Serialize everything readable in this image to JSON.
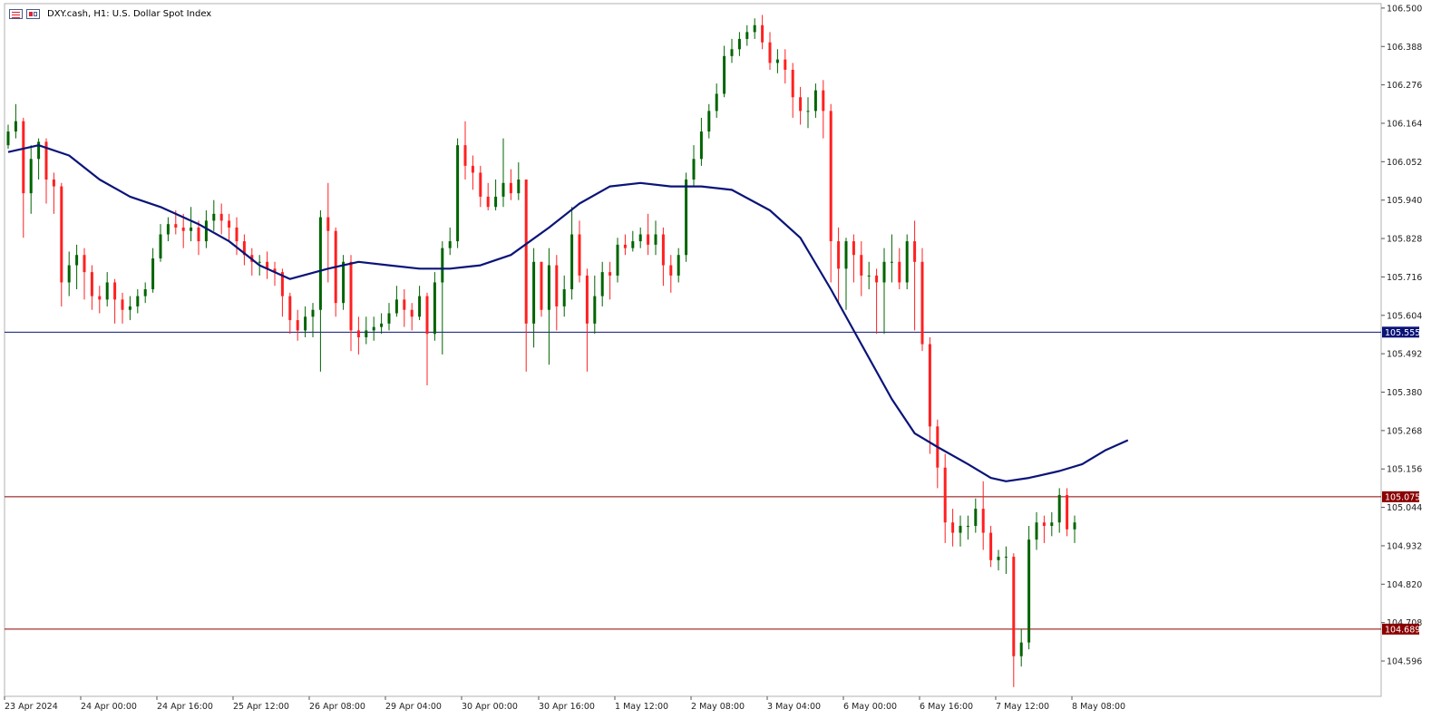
{
  "header": {
    "title": "DXY.cash, H1:  U.S. Dollar Spot Index"
  },
  "colors": {
    "up": "#006400",
    "down": "#ff2020",
    "ma": "#0a1478",
    "hline_current": "#0a1478",
    "hline_support": "#8b0000",
    "grid_frame": "#b0b0b0"
  },
  "chart_data": {
    "type": "candlestick",
    "title": "DXY.cash, H1:  U.S. Dollar Spot Index",
    "ylim": [
      104.53,
      106.505
    ],
    "y_ticks": [
      "106.500",
      "106.388",
      "106.276",
      "106.164",
      "106.052",
      "105.940",
      "105.828",
      "105.716",
      "105.604",
      "105.492",
      "105.380",
      "105.268",
      "105.156",
      "105.044",
      "104.932",
      "104.820",
      "104.708",
      "104.596"
    ],
    "x_ticks": [
      "23 Apr 2024",
      "24 Apr 00:00",
      "24 Apr 16:00",
      "25 Apr 12:00",
      "26 Apr 08:00",
      "29 Apr 04:00",
      "30 Apr 00:00",
      "30 Apr 16:00",
      "1 May 12:00",
      "2 May 08:00",
      "3 May 04:00",
      "6 May 00:00",
      "6 May 16:00",
      "7 May 12:00",
      "8 May 08:00"
    ],
    "hlines": [
      {
        "value": 105.555,
        "label": "105.555",
        "role": "current"
      },
      {
        "value": 105.075,
        "label": "105.075",
        "role": "support"
      },
      {
        "value": 104.689,
        "label": "104.689",
        "role": "support"
      }
    ],
    "ma_path": [
      [
        0,
        106.08
      ],
      [
        4,
        106.1
      ],
      [
        8,
        106.07
      ],
      [
        12,
        106.0
      ],
      [
        16,
        105.95
      ],
      [
        20,
        105.92
      ],
      [
        25,
        105.87
      ],
      [
        29,
        105.82
      ],
      [
        33,
        105.75
      ],
      [
        37,
        105.71
      ],
      [
        42,
        105.74
      ],
      [
        46,
        105.76
      ],
      [
        50,
        105.75
      ],
      [
        54,
        105.74
      ],
      [
        58,
        105.74
      ],
      [
        62,
        105.75
      ],
      [
        66,
        105.78
      ],
      [
        71,
        105.86
      ],
      [
        75,
        105.93
      ],
      [
        79,
        105.98
      ],
      [
        83,
        105.99
      ],
      [
        87,
        105.98
      ],
      [
        91,
        105.98
      ],
      [
        95,
        105.97
      ],
      [
        100,
        105.91
      ],
      [
        104,
        105.83
      ],
      [
        108,
        105.68
      ],
      [
        112,
        105.52
      ],
      [
        116,
        105.36
      ],
      [
        119,
        105.26
      ],
      [
        122,
        105.22
      ],
      [
        126,
        105.17
      ],
      [
        129,
        105.13
      ],
      [
        131,
        105.12
      ],
      [
        134,
        105.13
      ],
      [
        138,
        105.15
      ],
      [
        141,
        105.17
      ],
      [
        144,
        105.21
      ],
      [
        147,
        105.24
      ]
    ],
    "candles": [
      [
        106.1,
        106.14,
        106.16,
        106.09
      ],
      [
        106.14,
        106.17,
        106.22,
        106.12
      ],
      [
        106.17,
        105.96,
        106.18,
        105.83
      ],
      [
        105.96,
        106.06,
        106.1,
        105.9
      ],
      [
        106.06,
        106.11,
        106.12,
        106.0
      ],
      [
        106.11,
        106.0,
        106.12,
        105.93
      ],
      [
        106.0,
        105.98,
        106.02,
        105.9
      ],
      [
        105.98,
        105.7,
        105.99,
        105.63
      ],
      [
        105.7,
        105.75,
        105.79,
        105.66
      ],
      [
        105.75,
        105.78,
        105.81,
        105.68
      ],
      [
        105.78,
        105.73,
        105.8,
        105.65
      ],
      [
        105.73,
        105.66,
        105.75,
        105.62
      ],
      [
        105.66,
        105.65,
        105.69,
        105.61
      ],
      [
        105.65,
        105.7,
        105.73,
        105.63
      ],
      [
        105.7,
        105.65,
        105.71,
        105.58
      ],
      [
        105.65,
        105.62,
        105.67,
        105.58
      ],
      [
        105.62,
        105.63,
        105.66,
        105.59
      ],
      [
        105.63,
        105.66,
        105.68,
        105.61
      ],
      [
        105.66,
        105.68,
        105.7,
        105.64
      ],
      [
        105.68,
        105.77,
        105.8,
        105.67
      ],
      [
        105.77,
        105.84,
        105.87,
        105.76
      ],
      [
        105.84,
        105.87,
        105.89,
        105.82
      ],
      [
        105.87,
        105.86,
        105.91,
        105.84
      ],
      [
        105.86,
        105.85,
        105.9,
        105.8
      ],
      [
        105.85,
        105.86,
        105.92,
        105.82
      ],
      [
        105.86,
        105.82,
        105.88,
        105.78
      ],
      [
        105.82,
        105.88,
        105.91,
        105.8
      ],
      [
        105.88,
        105.9,
        105.94,
        105.85
      ],
      [
        105.9,
        105.88,
        105.93,
        105.84
      ],
      [
        105.88,
        105.86,
        105.9,
        105.82
      ],
      [
        105.86,
        105.82,
        105.89,
        105.78
      ],
      [
        105.82,
        105.78,
        105.84,
        105.75
      ],
      [
        105.78,
        105.76,
        105.8,
        105.72
      ],
      [
        105.76,
        105.76,
        105.78,
        105.72
      ],
      [
        105.76,
        105.74,
        105.79,
        105.71
      ],
      [
        105.74,
        105.73,
        105.76,
        105.69
      ],
      [
        105.73,
        105.66,
        105.74,
        105.6
      ],
      [
        105.66,
        105.59,
        105.67,
        105.55
      ],
      [
        105.59,
        105.56,
        105.62,
        105.53
      ],
      [
        105.56,
        105.6,
        105.63,
        105.54
      ],
      [
        105.6,
        105.62,
        105.64,
        105.54
      ],
      [
        105.62,
        105.89,
        105.91,
        105.44
      ],
      [
        105.89,
        105.85,
        105.99,
        105.7
      ],
      [
        105.85,
        105.64,
        105.86,
        105.6
      ],
      [
        105.64,
        105.76,
        105.78,
        105.62
      ],
      [
        105.76,
        105.56,
        105.78,
        105.5
      ],
      [
        105.56,
        105.54,
        105.6,
        105.49
      ],
      [
        105.54,
        105.56,
        105.6,
        105.52
      ],
      [
        105.56,
        105.57,
        105.6,
        105.53
      ],
      [
        105.57,
        105.58,
        105.61,
        105.55
      ],
      [
        105.58,
        105.61,
        105.64,
        105.56
      ],
      [
        105.61,
        105.65,
        105.69,
        105.6
      ],
      [
        105.65,
        105.62,
        105.68,
        105.57
      ],
      [
        105.62,
        105.6,
        105.64,
        105.56
      ],
      [
        105.6,
        105.66,
        105.69,
        105.59
      ],
      [
        105.66,
        105.55,
        105.67,
        105.4
      ],
      [
        105.55,
        105.7,
        105.73,
        105.53
      ],
      [
        105.7,
        105.8,
        105.82,
        105.49
      ],
      [
        105.8,
        105.82,
        105.86,
        105.78
      ],
      [
        105.82,
        106.1,
        106.12,
        105.8
      ],
      [
        106.1,
        106.04,
        106.17,
        106.0
      ],
      [
        106.04,
        106.02,
        106.07,
        105.97
      ],
      [
        106.02,
        105.95,
        106.04,
        105.92
      ],
      [
        105.95,
        105.92,
        105.99,
        105.91
      ],
      [
        105.92,
        105.95,
        106.0,
        105.91
      ],
      [
        105.95,
        105.99,
        106.12,
        105.92
      ],
      [
        105.99,
        105.96,
        106.03,
        105.94
      ],
      [
        105.96,
        106.0,
        106.05,
        105.94
      ],
      [
        106.0,
        105.58,
        106.0,
        105.44
      ],
      [
        105.58,
        105.76,
        105.8,
        105.51
      ],
      [
        105.76,
        105.62,
        105.76,
        105.6
      ],
      [
        105.62,
        105.75,
        105.8,
        105.46
      ],
      [
        105.75,
        105.63,
        105.78,
        105.56
      ],
      [
        105.63,
        105.68,
        105.72,
        105.6
      ],
      [
        105.68,
        105.84,
        105.92,
        105.65
      ],
      [
        105.84,
        105.72,
        105.88,
        105.7
      ],
      [
        105.72,
        105.58,
        105.74,
        105.44
      ],
      [
        105.58,
        105.66,
        105.72,
        105.55
      ],
      [
        105.66,
        105.73,
        105.76,
        105.63
      ],
      [
        105.73,
        105.72,
        105.76,
        105.65
      ],
      [
        105.72,
        105.81,
        105.83,
        105.7
      ],
      [
        105.81,
        105.8,
        105.84,
        105.78
      ],
      [
        105.8,
        105.82,
        105.85,
        105.79
      ],
      [
        105.82,
        105.84,
        105.86,
        105.8
      ],
      [
        105.84,
        105.81,
        105.9,
        105.78
      ],
      [
        105.81,
        105.84,
        105.88,
        105.78
      ],
      [
        105.84,
        105.75,
        105.86,
        105.69
      ],
      [
        105.75,
        105.72,
        105.78,
        105.67
      ],
      [
        105.72,
        105.78,
        105.8,
        105.7
      ],
      [
        105.78,
        106.0,
        106.02,
        105.76
      ],
      [
        106.0,
        106.06,
        106.1,
        105.98
      ],
      [
        106.06,
        106.14,
        106.18,
        106.04
      ],
      [
        106.14,
        106.2,
        106.22,
        106.12
      ],
      [
        106.2,
        106.25,
        106.28,
        106.18
      ],
      [
        106.25,
        106.36,
        106.39,
        106.24
      ],
      [
        106.36,
        106.38,
        106.41,
        106.34
      ],
      [
        106.38,
        106.41,
        106.43,
        106.36
      ],
      [
        106.41,
        106.43,
        106.45,
        106.39
      ],
      [
        106.43,
        106.45,
        106.47,
        106.41
      ],
      [
        106.45,
        106.4,
        106.48,
        106.38
      ],
      [
        106.4,
        106.34,
        106.43,
        106.32
      ],
      [
        106.34,
        106.35,
        106.38,
        106.31
      ],
      [
        106.35,
        106.32,
        106.38,
        106.28
      ],
      [
        106.32,
        106.24,
        106.34,
        106.18
      ],
      [
        106.24,
        106.2,
        106.27,
        106.16
      ],
      [
        106.2,
        106.2,
        106.24,
        106.15
      ],
      [
        106.2,
        106.26,
        106.28,
        106.18
      ],
      [
        106.26,
        106.2,
        106.29,
        106.12
      ],
      [
        106.2,
        105.82,
        106.22,
        105.7
      ],
      [
        105.82,
        105.74,
        105.86,
        105.64
      ],
      [
        105.74,
        105.82,
        105.83,
        105.62
      ],
      [
        105.82,
        105.78,
        105.84,
        105.7
      ],
      [
        105.78,
        105.72,
        105.82,
        105.66
      ],
      [
        105.72,
        105.72,
        105.76,
        105.68
      ],
      [
        105.72,
        105.7,
        105.74,
        105.55
      ],
      [
        105.7,
        105.76,
        105.8,
        105.55
      ],
      [
        105.76,
        105.76,
        105.84,
        105.7
      ],
      [
        105.76,
        105.7,
        105.8,
        105.68
      ],
      [
        105.7,
        105.82,
        105.84,
        105.68
      ],
      [
        105.82,
        105.76,
        105.88,
        105.56
      ],
      [
        105.76,
        105.52,
        105.8,
        105.5
      ],
      [
        105.52,
        105.28,
        105.54,
        105.2
      ],
      [
        105.28,
        105.16,
        105.3,
        105.1
      ],
      [
        105.16,
        105.0,
        105.2,
        104.94
      ],
      [
        105.0,
        104.97,
        105.04,
        104.93
      ],
      [
        104.97,
        104.99,
        105.02,
        104.93
      ],
      [
        104.99,
        104.99,
        105.02,
        104.95
      ],
      [
        104.99,
        105.04,
        105.07,
        104.97
      ],
      [
        105.04,
        104.97,
        105.12,
        104.92
      ],
      [
        104.97,
        104.89,
        104.99,
        104.87
      ],
      [
        104.89,
        104.9,
        104.92,
        104.86
      ],
      [
        104.9,
        104.9,
        104.93,
        104.85
      ],
      [
        104.9,
        104.61,
        104.91,
        104.52
      ],
      [
        104.61,
        104.65,
        104.69,
        104.58
      ],
      [
        104.65,
        104.95,
        104.99,
        104.63
      ],
      [
        104.95,
        105.0,
        105.03,
        104.92
      ],
      [
        105.0,
        104.99,
        105.02,
        104.94
      ],
      [
        104.99,
        105.0,
        105.03,
        104.96
      ],
      [
        105.0,
        105.08,
        105.1,
        104.97
      ],
      [
        105.08,
        104.98,
        105.1,
        104.96
      ],
      [
        104.98,
        105.0,
        105.02,
        104.94
      ]
    ]
  }
}
